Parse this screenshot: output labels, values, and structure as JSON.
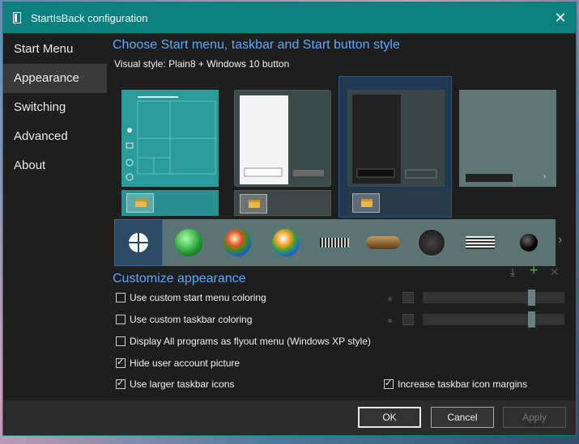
{
  "window": {
    "title": "StartIsBack configuration"
  },
  "sidebar": {
    "items": [
      {
        "label": "Start Menu"
      },
      {
        "label": "Appearance",
        "active": true
      },
      {
        "label": "Switching"
      },
      {
        "label": "Advanced"
      },
      {
        "label": "About"
      }
    ]
  },
  "main": {
    "heading": "Choose Start menu, taskbar and Start button style",
    "visual_style_label": "Visual style:",
    "visual_style_value": "Plain8 + Windows 10 button",
    "orbs": [
      "windows-10-logo-icon",
      "clover-orb-icon",
      "windows-7-orb-icon",
      "windows-vista-orb-icon",
      "battery-bar-icon",
      "steampunk-button-icon",
      "atom-orb-icon",
      "striped-bar-icon",
      "black-orb-icon"
    ],
    "customize_heading": "Customize appearance",
    "options": [
      {
        "label": "Use custom start menu coloring",
        "checked": false
      },
      {
        "label": "Use custom taskbar coloring",
        "checked": false
      },
      {
        "label": "Display All programs as flyout menu (Windows XP style)",
        "checked": false
      },
      {
        "label": "Hide user account picture",
        "checked": true
      },
      {
        "label": "Use larger taskbar icons",
        "checked": true
      },
      {
        "label": "Increase taskbar icon margins",
        "checked": true
      }
    ]
  },
  "buttons": {
    "ok": "OK",
    "cancel": "Cancel",
    "apply": "Apply"
  },
  "colors": {
    "accent": "#5aa9ff",
    "titlebar": "#0f8080",
    "background": "#1e1e1e"
  }
}
